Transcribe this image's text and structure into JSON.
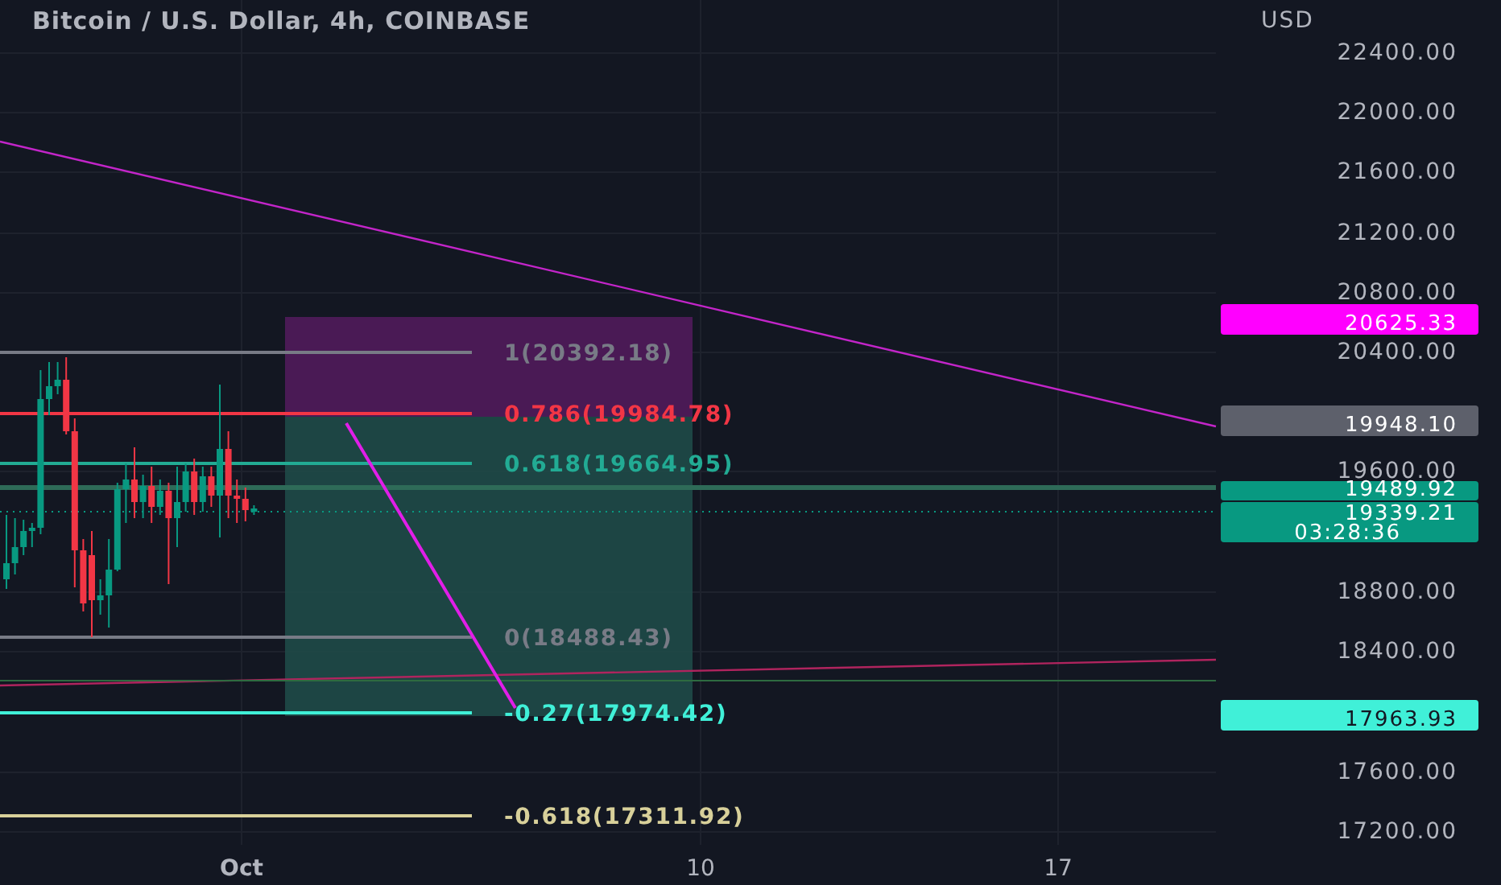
{
  "title": "Bitcoin / U.S. Dollar, 4h, COINBASE",
  "currency": "USD",
  "price_ticks": [
    "22400.00",
    "22000.00",
    "21600.00",
    "21200.00",
    "20800.00",
    "20400.00",
    "19600.00",
    "18800.00",
    "18400.00",
    "17600.00",
    "17200.00"
  ],
  "price_labels": [
    {
      "text": "20625.33",
      "color": "#ff00ff"
    },
    {
      "text": "19948.10",
      "color": "#5d606b"
    },
    {
      "text": "19489.92",
      "color": "#089981"
    },
    {
      "text": "19339.21",
      "sub": "03:28:36",
      "color": "#089981"
    },
    {
      "text": "17963.93",
      "color": "#40f0d8"
    }
  ],
  "fib_levels": [
    {
      "label": "1(20392.18)",
      "color": "#787b86"
    },
    {
      "label": "0.786(19984.78)",
      "color": "#f23645"
    },
    {
      "label": "0.618(19664.95)",
      "color": "#22ab94"
    },
    {
      "label": "0(18488.43)",
      "color": "#787b86"
    },
    {
      "label": "-0.27(17974.42)",
      "color": "#40f0d8"
    },
    {
      "label": "-0.618(17311.92)",
      "color": "#d8d09a"
    }
  ],
  "time_labels": [
    {
      "text": "Oct",
      "emphasized": true
    },
    {
      "text": "10",
      "emphasized": false
    },
    {
      "text": "17",
      "emphasized": false
    }
  ]
}
